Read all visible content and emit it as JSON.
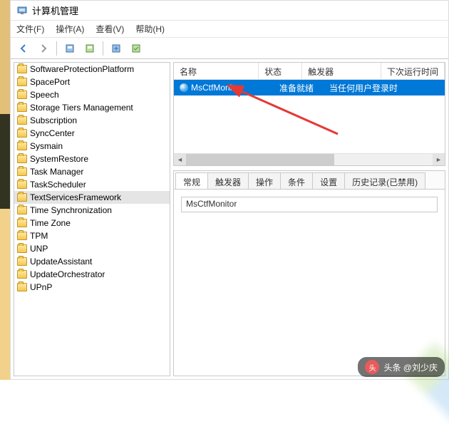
{
  "window": {
    "title": "计算机管理"
  },
  "menu": {
    "file": "文件(F)",
    "action": "操作(A)",
    "view": "查看(V)",
    "help": "帮助(H)"
  },
  "sidebar": {
    "items": [
      {
        "label": "SoftwareProtectionPlatform"
      },
      {
        "label": "SpacePort"
      },
      {
        "label": "Speech"
      },
      {
        "label": "Storage Tiers Management"
      },
      {
        "label": "Subscription"
      },
      {
        "label": "SyncCenter"
      },
      {
        "label": "Sysmain"
      },
      {
        "label": "SystemRestore"
      },
      {
        "label": "Task Manager"
      },
      {
        "label": "TaskScheduler"
      },
      {
        "label": "TextServicesFramework",
        "selected": true
      },
      {
        "label": "Time Synchronization"
      },
      {
        "label": "Time Zone"
      },
      {
        "label": "TPM"
      },
      {
        "label": "UNP"
      },
      {
        "label": "UpdateAssistant"
      },
      {
        "label": "UpdateOrchestrator"
      },
      {
        "label": "UPnP"
      }
    ]
  },
  "tasks": {
    "columns": {
      "name": "名称",
      "status": "状态",
      "trigger": "触发器",
      "nextrun": "下次运行时间"
    },
    "rows": [
      {
        "name": "MsCtfMonitor",
        "status": "准备就绪",
        "trigger": "当任何用户登录时",
        "selected": true
      }
    ]
  },
  "detail": {
    "tabs": {
      "general": "常规",
      "triggers": "触发器",
      "actions": "操作",
      "conditions": "条件",
      "settings": "设置",
      "history": "历史记录(已禁用)"
    },
    "name_value": "MsCtfMonitor"
  },
  "footer": {
    "label": "头条 @刘少庆"
  }
}
